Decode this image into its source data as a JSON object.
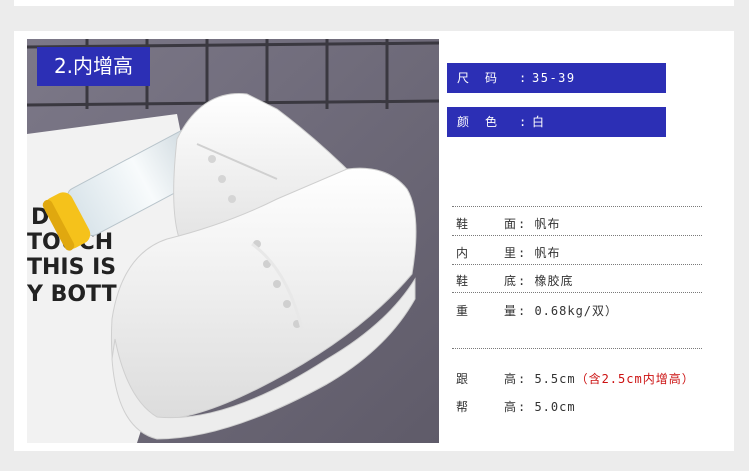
{
  "badge": {
    "label": "2.内增高"
  },
  "specs_highlight": [
    {
      "key": "尺　码",
      "sep": ":",
      "value": "35-39"
    },
    {
      "key": "颜　色",
      "sep": ":",
      "value": "白"
    }
  ],
  "specs_material": [
    {
      "key": "鞋　面",
      "value": ": 帆布"
    },
    {
      "key": "内　里",
      "value": ": 帆布"
    },
    {
      "key": "鞋　底",
      "value": ": 橡胶底"
    },
    {
      "key": "重　量",
      "value": ": 0.68kg/双）"
    }
  ],
  "specs_height": {
    "heel": {
      "key": "跟　高",
      "value": ":  5.5cm",
      "note": "（含2.5cm内增高）"
    },
    "platform": {
      "key": "帮　高",
      "value": ":  5.0cm"
    }
  },
  "photo_text": {
    "line1": "DOI",
    "line2": "TOUCH",
    "line3": "THIS IS",
    "line4": "Y BOTT"
  },
  "colors": {
    "accent": "#2c2fb5",
    "note_red": "#cc1111",
    "shoe_white": "#f4f4f4",
    "carpet": "#6e6a78",
    "bottle_cap": "#f5c21b"
  }
}
